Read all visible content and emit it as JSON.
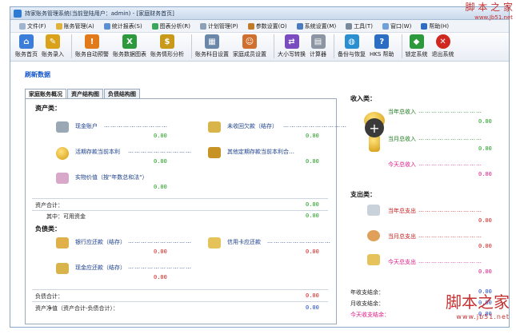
{
  "watermark": {
    "logo": "脚 本 之 家",
    "url": "www.Jb51.net",
    "bottom_logo": "脚本之家",
    "bottom_url": "www.jb51.net"
  },
  "window": {
    "title": "持家账务管理系统(当前登陆用户：admin) - [家庭财务首页]"
  },
  "menu": [
    "文件(F)",
    "账务管理(A)",
    "统计报表(S)",
    "图表分析(R)",
    "计划管理(P)",
    "参数设置(O)",
    "系统设置(M)",
    "工具(T)",
    "窗口(W)",
    "帮助(H)"
  ],
  "toolbar": {
    "items": [
      {
        "label": "账务首页",
        "icon": "home-icon",
        "color": "#3b7dd8"
      },
      {
        "label": "账务录入",
        "icon": "pencil-icon",
        "color": "#d9a21a"
      },
      {
        "label": "账务自动预警",
        "icon": "alarm-icon",
        "color": "#e07a1a"
      },
      {
        "label": "账务数据图表",
        "icon": "excel-icon",
        "color": "#2c9a3c"
      },
      {
        "label": "账务情形分析",
        "icon": "moneybag-icon",
        "color": "#c99a1a"
      },
      {
        "label": "账务科目设置",
        "icon": "grid-icon",
        "color": "#6a86a8"
      },
      {
        "label": "家庭成员设置",
        "icon": "family-icon",
        "color": "#d07030"
      },
      {
        "label": "大小写转换",
        "icon": "convert-icon",
        "color": "#7a4cc0"
      },
      {
        "label": "计算器",
        "icon": "calculator-icon",
        "color": "#8c96a2"
      },
      {
        "label": "备份与恢复",
        "icon": "globe-icon",
        "color": "#2a8fd0"
      },
      {
        "label": "HKS 帮助",
        "icon": "help-icon",
        "color": "#2b6dc2"
      },
      {
        "label": "锁定系统",
        "icon": "lock-icon",
        "color": "#2c9a3c"
      },
      {
        "label": "退出系统",
        "icon": "exit-icon",
        "color": "#d0281f"
      }
    ]
  },
  "page": {
    "refresh": "刷新数据"
  },
  "tabs": [
    "家庭账务概况",
    "资产结构图",
    "负债结构图"
  ],
  "assets": {
    "title": "资产类：",
    "items": [
      {
        "label": "现金账户",
        "value": "0.00"
      },
      {
        "label": "未收回欠款（结存）",
        "value": "0.00"
      },
      {
        "label": "活期存款当前本利",
        "value": "0.00"
      },
      {
        "label": "其他定期存款当前本利合…",
        "value": "0.00"
      },
      {
        "label": "实物价值（按\"年数总和法\"）",
        "value": "0.00"
      }
    ],
    "total_label": "资产合计：",
    "total_value": "0.00",
    "liquid_label": "其中：可用资金",
    "liquid_value": "0.00"
  },
  "liabilities": {
    "title": "负债类：",
    "items": [
      {
        "label": "银行应还款（结存）",
        "value": "0.00"
      },
      {
        "label": "信用卡应还款",
        "value": "0.00"
      },
      {
        "label": "现金应还款（结存）",
        "value": "0.00"
      }
    ],
    "total_label": "负债合计：",
    "total_value": "0.00",
    "net_label": "资产净值（资产合计-负债合计）：",
    "net_value": "0.00"
  },
  "income": {
    "title": "收入类：",
    "year_label": "当年总收入",
    "year_value": "0.00",
    "month_label": "当月总收入",
    "month_value": "0.00",
    "today_label": "今天总收入",
    "today_value": "0.00"
  },
  "expense": {
    "title": "支出类：",
    "year_label": "当年总支出",
    "year_value": "0.00",
    "month_label": "当月总支出",
    "month_value": "0.00",
    "today_label": "今天总支出",
    "today_value": "0.00"
  },
  "summary": {
    "year_label": "年收支结余：",
    "year_value": "0.00",
    "month_label": "月收支结余：",
    "month_value": "0.00",
    "today_label": "今天收支结余：",
    "today_value": "0.00"
  },
  "dots": "…………………………"
}
